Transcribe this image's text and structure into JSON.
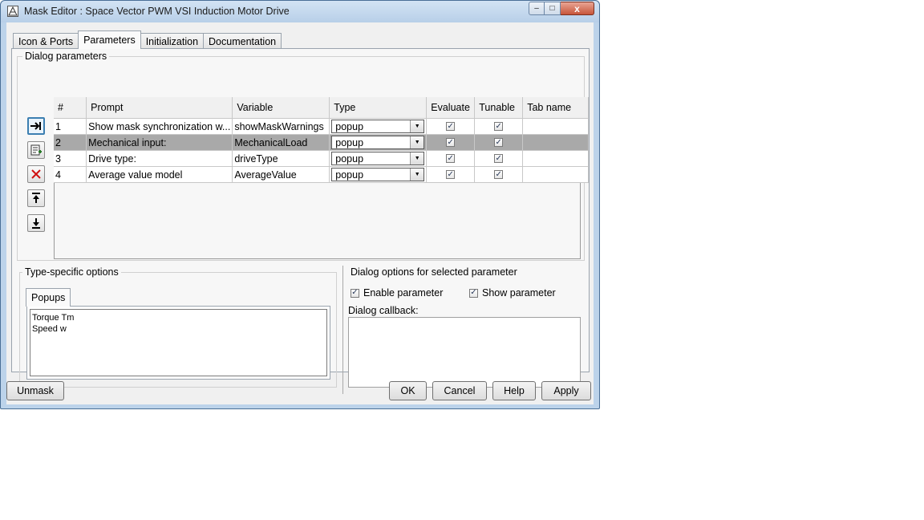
{
  "window": {
    "title": "Mask Editor : Space Vector PWM VSI Induction Motor Drive",
    "controls": {
      "minimize": "–",
      "maximize": "□",
      "close": "x"
    }
  },
  "tabs": [
    "Icon & Ports",
    "Parameters",
    "Initialization",
    "Documentation"
  ],
  "active_tab": "Parameters",
  "dialog_parameters": {
    "title": "Dialog parameters",
    "columns": [
      "#",
      "Prompt",
      "Variable",
      "Type",
      "Evaluate",
      "Tunable",
      "Tab name"
    ],
    "rows": [
      {
        "num": "1",
        "prompt": "Show mask synchronization w...",
        "variable": "showMaskWarnings",
        "type": "popup",
        "evaluate": true,
        "tunable": true,
        "tab_name": ""
      },
      {
        "num": "2",
        "prompt": "Mechanical input:",
        "variable": "MechanicalLoad",
        "type": "popup",
        "evaluate": true,
        "tunable": true,
        "tab_name": "",
        "selected": true
      },
      {
        "num": "3",
        "prompt": "Drive type:",
        "variable": "driveType",
        "type": "popup",
        "evaluate": true,
        "tunable": true,
        "tab_name": ""
      },
      {
        "num": "4",
        "prompt": "Average value model",
        "variable": "AverageValue",
        "type": "popup",
        "evaluate": true,
        "tunable": true,
        "tab_name": ""
      }
    ],
    "side_buttons": [
      "insert-parameter-icon",
      "add-parameter-icon",
      "delete-icon",
      "move-up-icon",
      "move-down-icon"
    ]
  },
  "type_specific": {
    "title": "Type-specific options",
    "tab": "Popups",
    "lines": [
      "Torque Tm",
      "Speed w"
    ]
  },
  "dialog_options": {
    "title": "Dialog options for selected parameter",
    "enable_label": "Enable parameter",
    "enable_checked": true,
    "show_label": "Show parameter",
    "show_checked": true,
    "callback_label": "Dialog callback:",
    "callback_value": ""
  },
  "buttons": {
    "unmask": "Unmask",
    "ok": "OK",
    "cancel": "Cancel",
    "help": "Help",
    "apply": "Apply"
  },
  "colors": {
    "selected_row": "#a9a9a9",
    "title_bar": "#c9dcf0",
    "close_button": "#c7553a"
  }
}
